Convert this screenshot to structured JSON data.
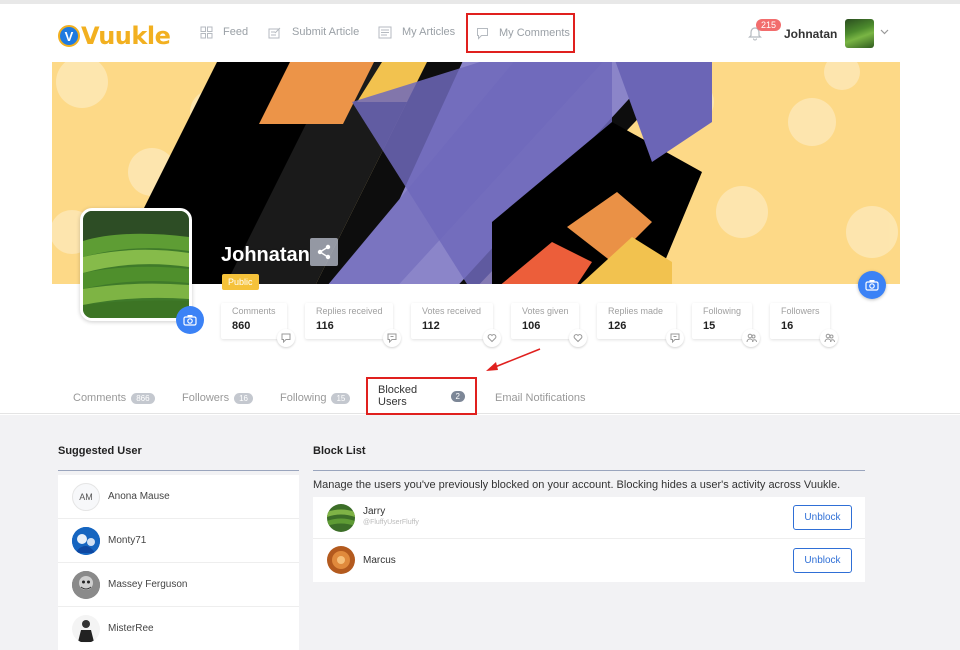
{
  "header": {
    "logo_letter": "V",
    "logo_text": "Vuukle",
    "nav": {
      "feed": "Feed",
      "submit": "Submit Article",
      "articles": "My Articles",
      "comments": "My Comments"
    },
    "notification_count": "215",
    "username": "Johnatan"
  },
  "profile": {
    "name": "Johnatan",
    "visibility": "Public",
    "stats": [
      {
        "label": "Comments",
        "value": "860"
      },
      {
        "label": "Replies received",
        "value": "116"
      },
      {
        "label": "Votes received",
        "value": "112"
      },
      {
        "label": "Votes given",
        "value": "106"
      },
      {
        "label": "Replies made",
        "value": "126"
      },
      {
        "label": "Following",
        "value": "15"
      },
      {
        "label": "Followers",
        "value": "16"
      }
    ]
  },
  "tabs": [
    {
      "label": "Comments",
      "count": "866"
    },
    {
      "label": "Followers",
      "count": "16"
    },
    {
      "label": "Following",
      "count": "15"
    },
    {
      "label": "Blocked Users",
      "count": "2"
    },
    {
      "label": "Email Notifications",
      "count": ""
    }
  ],
  "suggested": {
    "title": "Suggested User",
    "users": [
      {
        "name": "Anona Mause",
        "initials": "AM"
      },
      {
        "name": "Monty71",
        "initials": ""
      },
      {
        "name": "Massey Ferguson",
        "initials": ""
      },
      {
        "name": "MisterRee",
        "initials": ""
      }
    ]
  },
  "block_list": {
    "title": "Block List",
    "description": "Manage the users you've previously blocked on your account. Blocking hides a user's activity across Vuukle.",
    "users": [
      {
        "name": "Jarry",
        "handle": "@FluffyUserFluffy",
        "button": "Unblock"
      },
      {
        "name": "Marcus",
        "handle": "",
        "button": "Unblock"
      }
    ]
  },
  "colors": {
    "accent_blue": "#2f6fd6",
    "logo_yellow": "#f2b020",
    "highlight_red": "#e0201e",
    "public_badge": "#f5c23a"
  }
}
